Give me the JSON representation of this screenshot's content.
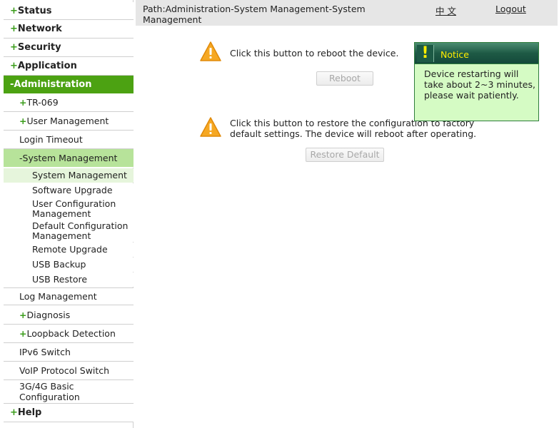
{
  "header": {
    "path": "Path:Administration-System Management-System Management",
    "language_link": "中 文",
    "logout_link": "Logout"
  },
  "sidebar": {
    "status": {
      "plus": "+",
      "label": "Status"
    },
    "network": {
      "plus": "+",
      "label": "Network"
    },
    "security": {
      "plus": "+",
      "label": "Security"
    },
    "application": {
      "plus": "+",
      "label": "Application"
    },
    "administration": {
      "plus": "-",
      "label": "Administration"
    },
    "tr069": {
      "plus": "+",
      "label": "TR-069"
    },
    "user_management": {
      "plus": "+",
      "label": "User Management"
    },
    "login_timeout": {
      "label": "Login Timeout"
    },
    "system_management": {
      "plus": "-",
      "label": "System Management"
    },
    "leaf_system_management": "System Management",
    "leaf_software_upgrade": "Software Upgrade",
    "leaf_user_config": "User Configuration Management",
    "leaf_default_config": "Default Configuration Management",
    "leaf_remote_upgrade": "Remote Upgrade",
    "leaf_usb_backup": "USB Backup",
    "leaf_usb_restore": "USB Restore",
    "log_management": {
      "label": "Log Management"
    },
    "diagnosis": {
      "plus": "+",
      "label": "Diagnosis"
    },
    "loopback": {
      "plus": "+",
      "label": "Loopback Detection"
    },
    "ipv6_switch": {
      "label": "IPv6 Switch"
    },
    "voip_switch": {
      "label": "VoIP Protocol Switch"
    },
    "g34_config": {
      "label": "3G/4G Basic Configuration"
    },
    "help": {
      "plus": "+",
      "label": "Help"
    }
  },
  "main": {
    "reboot_text": "Click this button to reboot the device.",
    "reboot_button": "Reboot",
    "restore_text": "Click this button to restore the configuration to factory default settings. The device will reboot after operating.",
    "restore_button": "Restore Default"
  },
  "notice": {
    "icon": "!",
    "title": "Notice",
    "message": "Device restarting will take about 2~3 minutes, please wait patiently."
  },
  "colors": {
    "active_menu_bg": "#4ca212",
    "active_submenu_bg": "#b7e39a",
    "notice_bg": "#d5fbc4",
    "notice_title": "#ffee00"
  }
}
